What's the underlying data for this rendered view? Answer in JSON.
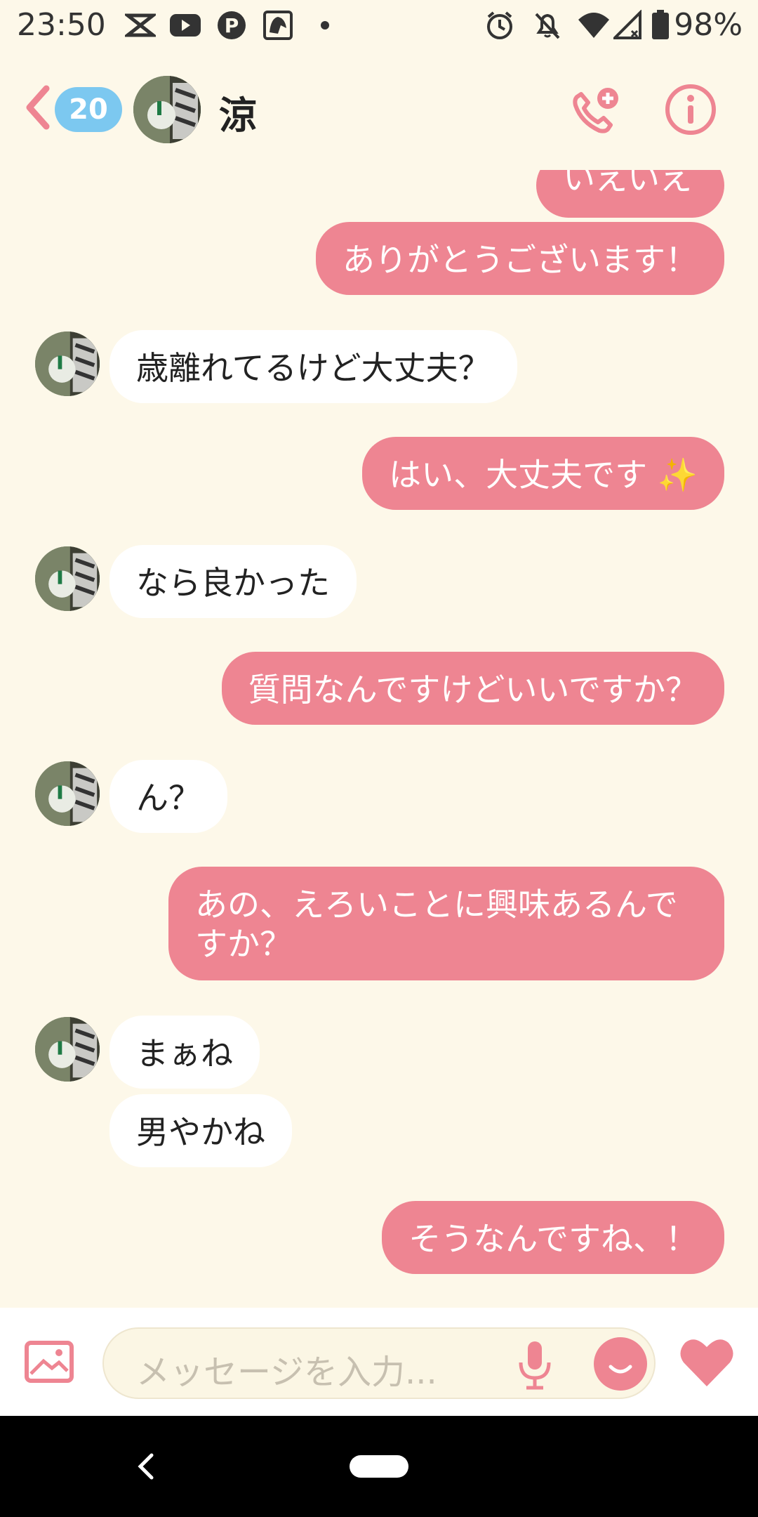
{
  "status_bar": {
    "time": "23:50",
    "battery": "98%",
    "icons": [
      "capcut-icon",
      "youtube-icon",
      "pinterest-icon",
      "app-icon",
      "dot-icon",
      "alarm-icon",
      "mute-icon",
      "wifi-icon",
      "signal-icon",
      "battery-icon"
    ]
  },
  "header": {
    "unread_count": "20",
    "contact_name": "涼",
    "accent_color": "#ee8592",
    "badge_color": "#7cc8f0"
  },
  "messages": [
    {
      "from": "me",
      "text": "いえいえ"
    },
    {
      "from": "me",
      "text": "ありがとうございます！"
    },
    {
      "from": "them",
      "text": "歳離れてるけど大丈夫？"
    },
    {
      "from": "me",
      "text": "はい、大丈夫です",
      "emoji": "✨"
    },
    {
      "from": "them",
      "text": "なら良かった"
    },
    {
      "from": "me",
      "text": "質問なんですけどいいですか？"
    },
    {
      "from": "them",
      "text": "ん？"
    },
    {
      "from": "me",
      "text": "あの、えろいことに興味あるんですか？"
    },
    {
      "from": "them",
      "text": "まぁね"
    },
    {
      "from": "them",
      "text": "男やかね"
    },
    {
      "from": "me",
      "text": "そうなんですね、！"
    }
  ],
  "input": {
    "placeholder": "メッセージを入力..."
  },
  "colors": {
    "background": "#fdf8e9",
    "my_bubble": "#ee8592",
    "their_bubble": "#ffffff"
  }
}
